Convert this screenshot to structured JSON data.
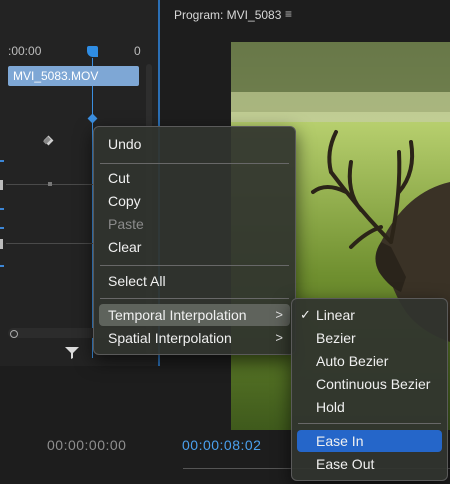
{
  "effect_controls": {
    "ruler_start": ":00:00",
    "ruler_end": "0",
    "clip_name": "MVI_5083.MOV",
    "timecode": "00:00:00:00"
  },
  "program_monitor": {
    "title": "Program: MVI_5083",
    "menu_icon": "≡",
    "timecode": "00:00:08:02"
  },
  "context_menu": {
    "undo": "Undo",
    "cut": "Cut",
    "copy": "Copy",
    "paste": "Paste",
    "clear": "Clear",
    "select_all": "Select All",
    "temporal_interpolation": "Temporal Interpolation",
    "spatial_interpolation": "Spatial Interpolation",
    "submenu_arrow": ">"
  },
  "interpolation_submenu": {
    "check": "✓",
    "linear": "Linear",
    "bezier": "Bezier",
    "auto_bezier": "Auto Bezier",
    "continuous_bezier": "Continuous Bezier",
    "hold": "Hold",
    "ease_in": "Ease In",
    "ease_out": "Ease Out"
  },
  "colors": {
    "accent_blue": "#2f8de4",
    "menu_highlight": "#2566c9"
  }
}
